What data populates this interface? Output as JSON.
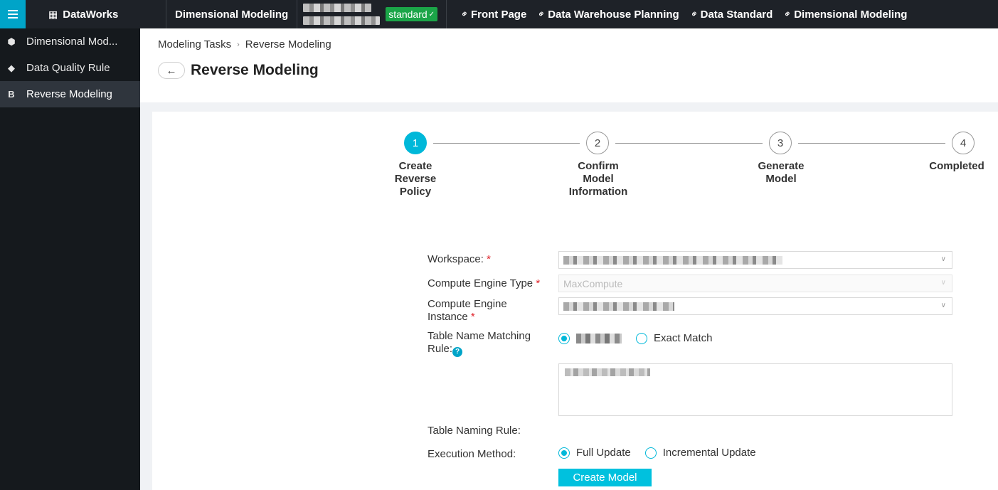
{
  "topbar": {
    "brand": "DataWorks",
    "brand_icon": "dataworks-logo-icon",
    "module": "Dimensional Modeling",
    "environment": "standard",
    "links": [
      {
        "label": "Front Page",
        "icon": "link-icon"
      },
      {
        "label": "Data Warehouse Planning",
        "icon": "link-icon"
      },
      {
        "label": "Data Standard",
        "icon": "link-icon"
      },
      {
        "label": "Dimensional Modeling",
        "icon": "link-icon"
      }
    ]
  },
  "sidebar": {
    "items": [
      {
        "label": "Dimensional Mod...",
        "icon": "cube-icon",
        "active": false
      },
      {
        "label": "Data Quality Rule",
        "icon": "diamond-icon",
        "active": false
      },
      {
        "label": "Reverse Modeling",
        "icon": "reverse-model-icon",
        "active": true
      }
    ]
  },
  "breadcrumb": {
    "items": [
      "Modeling Tasks",
      "Reverse Modeling"
    ],
    "separator": "›"
  },
  "page": {
    "title": "Reverse Modeling",
    "back_symbol": "←"
  },
  "steps": [
    {
      "number": "1",
      "lines": [
        "Create",
        "Reverse",
        "Policy"
      ],
      "status": "current"
    },
    {
      "number": "2",
      "lines": [
        "Confirm",
        "Model",
        "Information"
      ],
      "status": "pending"
    },
    {
      "number": "3",
      "lines": [
        "Generate",
        "Model"
      ],
      "status": "pending"
    },
    {
      "number": "4",
      "lines": [
        "Completed"
      ],
      "status": "pending"
    }
  ],
  "form": {
    "workspace_label": "Workspace:",
    "engine_type_label": "Compute Engine Type",
    "engine_type_value": "MaxCompute",
    "engine_instance_label_1": "Compute Engine",
    "engine_instance_label_2": "Instance",
    "required_mark": "*",
    "match_rule_label_1": "Table Name Matching",
    "match_rule_label_2": "Rule:",
    "help_symbol": "?",
    "exact_match_label": "Exact Match",
    "naming_rule_label": "Table Naming Rule:",
    "execution_label": "Execution Method:",
    "full_update_label": "Full Update",
    "incremental_update_label": "Incremental Update",
    "execution_selected": "Full Update",
    "submit_label": "Create Model"
  },
  "colors": {
    "accent": "#00b8d9",
    "topbar": "#1e2228",
    "sidebar": "#15191d",
    "env_badge": "#1ba548",
    "required": "#e0242b"
  }
}
